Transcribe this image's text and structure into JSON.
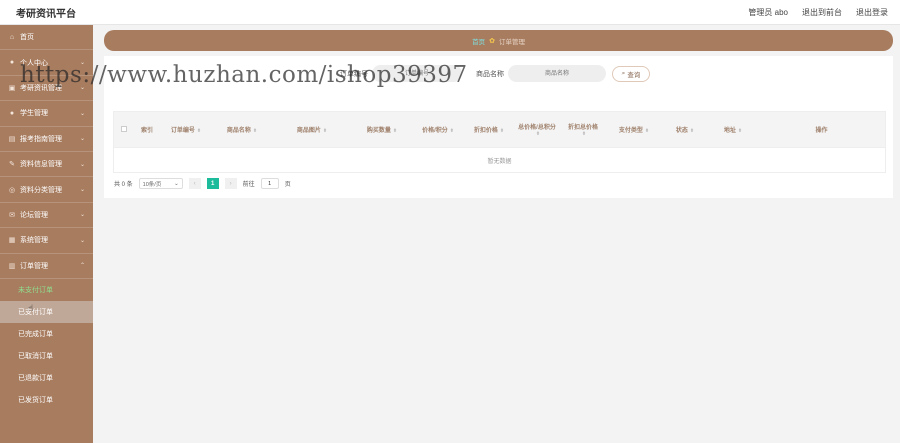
{
  "app": {
    "title": "考研资讯平台",
    "user_label": "管理员 abo",
    "front_link": "退出到前台",
    "logout": "退出登录"
  },
  "sidebar": {
    "items": [
      {
        "label": "首页",
        "icon": "home-icon"
      },
      {
        "label": "个人中心",
        "icon": "user-icon"
      },
      {
        "label": "考研资讯管理",
        "icon": "news-icon"
      },
      {
        "label": "学生管理",
        "icon": "student-icon"
      },
      {
        "label": "报考指南管理",
        "icon": "guide-icon"
      },
      {
        "label": "资料信息管理",
        "icon": "info-icon"
      },
      {
        "label": "资料分类管理",
        "icon": "category-icon"
      },
      {
        "label": "论坛管理",
        "icon": "forum-icon"
      },
      {
        "label": "系统管理",
        "icon": "system-icon"
      },
      {
        "label": "订单管理",
        "icon": "order-icon"
      }
    ],
    "sub_items": [
      {
        "label": "未支付订单"
      },
      {
        "label": "已支付订单"
      },
      {
        "label": "已完成订单"
      },
      {
        "label": "已取消订单"
      },
      {
        "label": "已退款订单"
      },
      {
        "label": "已发货订单"
      }
    ]
  },
  "breadcrumb": {
    "home": "首页",
    "current": "订单管理"
  },
  "search": {
    "label1": "订单编号",
    "placeholder1": "订单编号",
    "label2": "商品名称",
    "placeholder2": "商品名称",
    "button": "查询"
  },
  "table": {
    "headers": [
      "索引",
      "订单编号",
      "商品名称",
      "商品图片",
      "购买数量",
      "价格/积分",
      "折扣价格",
      "总价格/总积分",
      "折扣总价格",
      "支付类型",
      "状态",
      "地址",
      "操作"
    ],
    "empty_text": "暂无数据"
  },
  "pagination": {
    "total": "共 0 条",
    "page_size": "10条/页",
    "current_page": "1",
    "goto_label": "前往",
    "goto_value": "1",
    "page_suffix": "页"
  },
  "watermark": "https://www.huzhan.com/ishop39397"
}
